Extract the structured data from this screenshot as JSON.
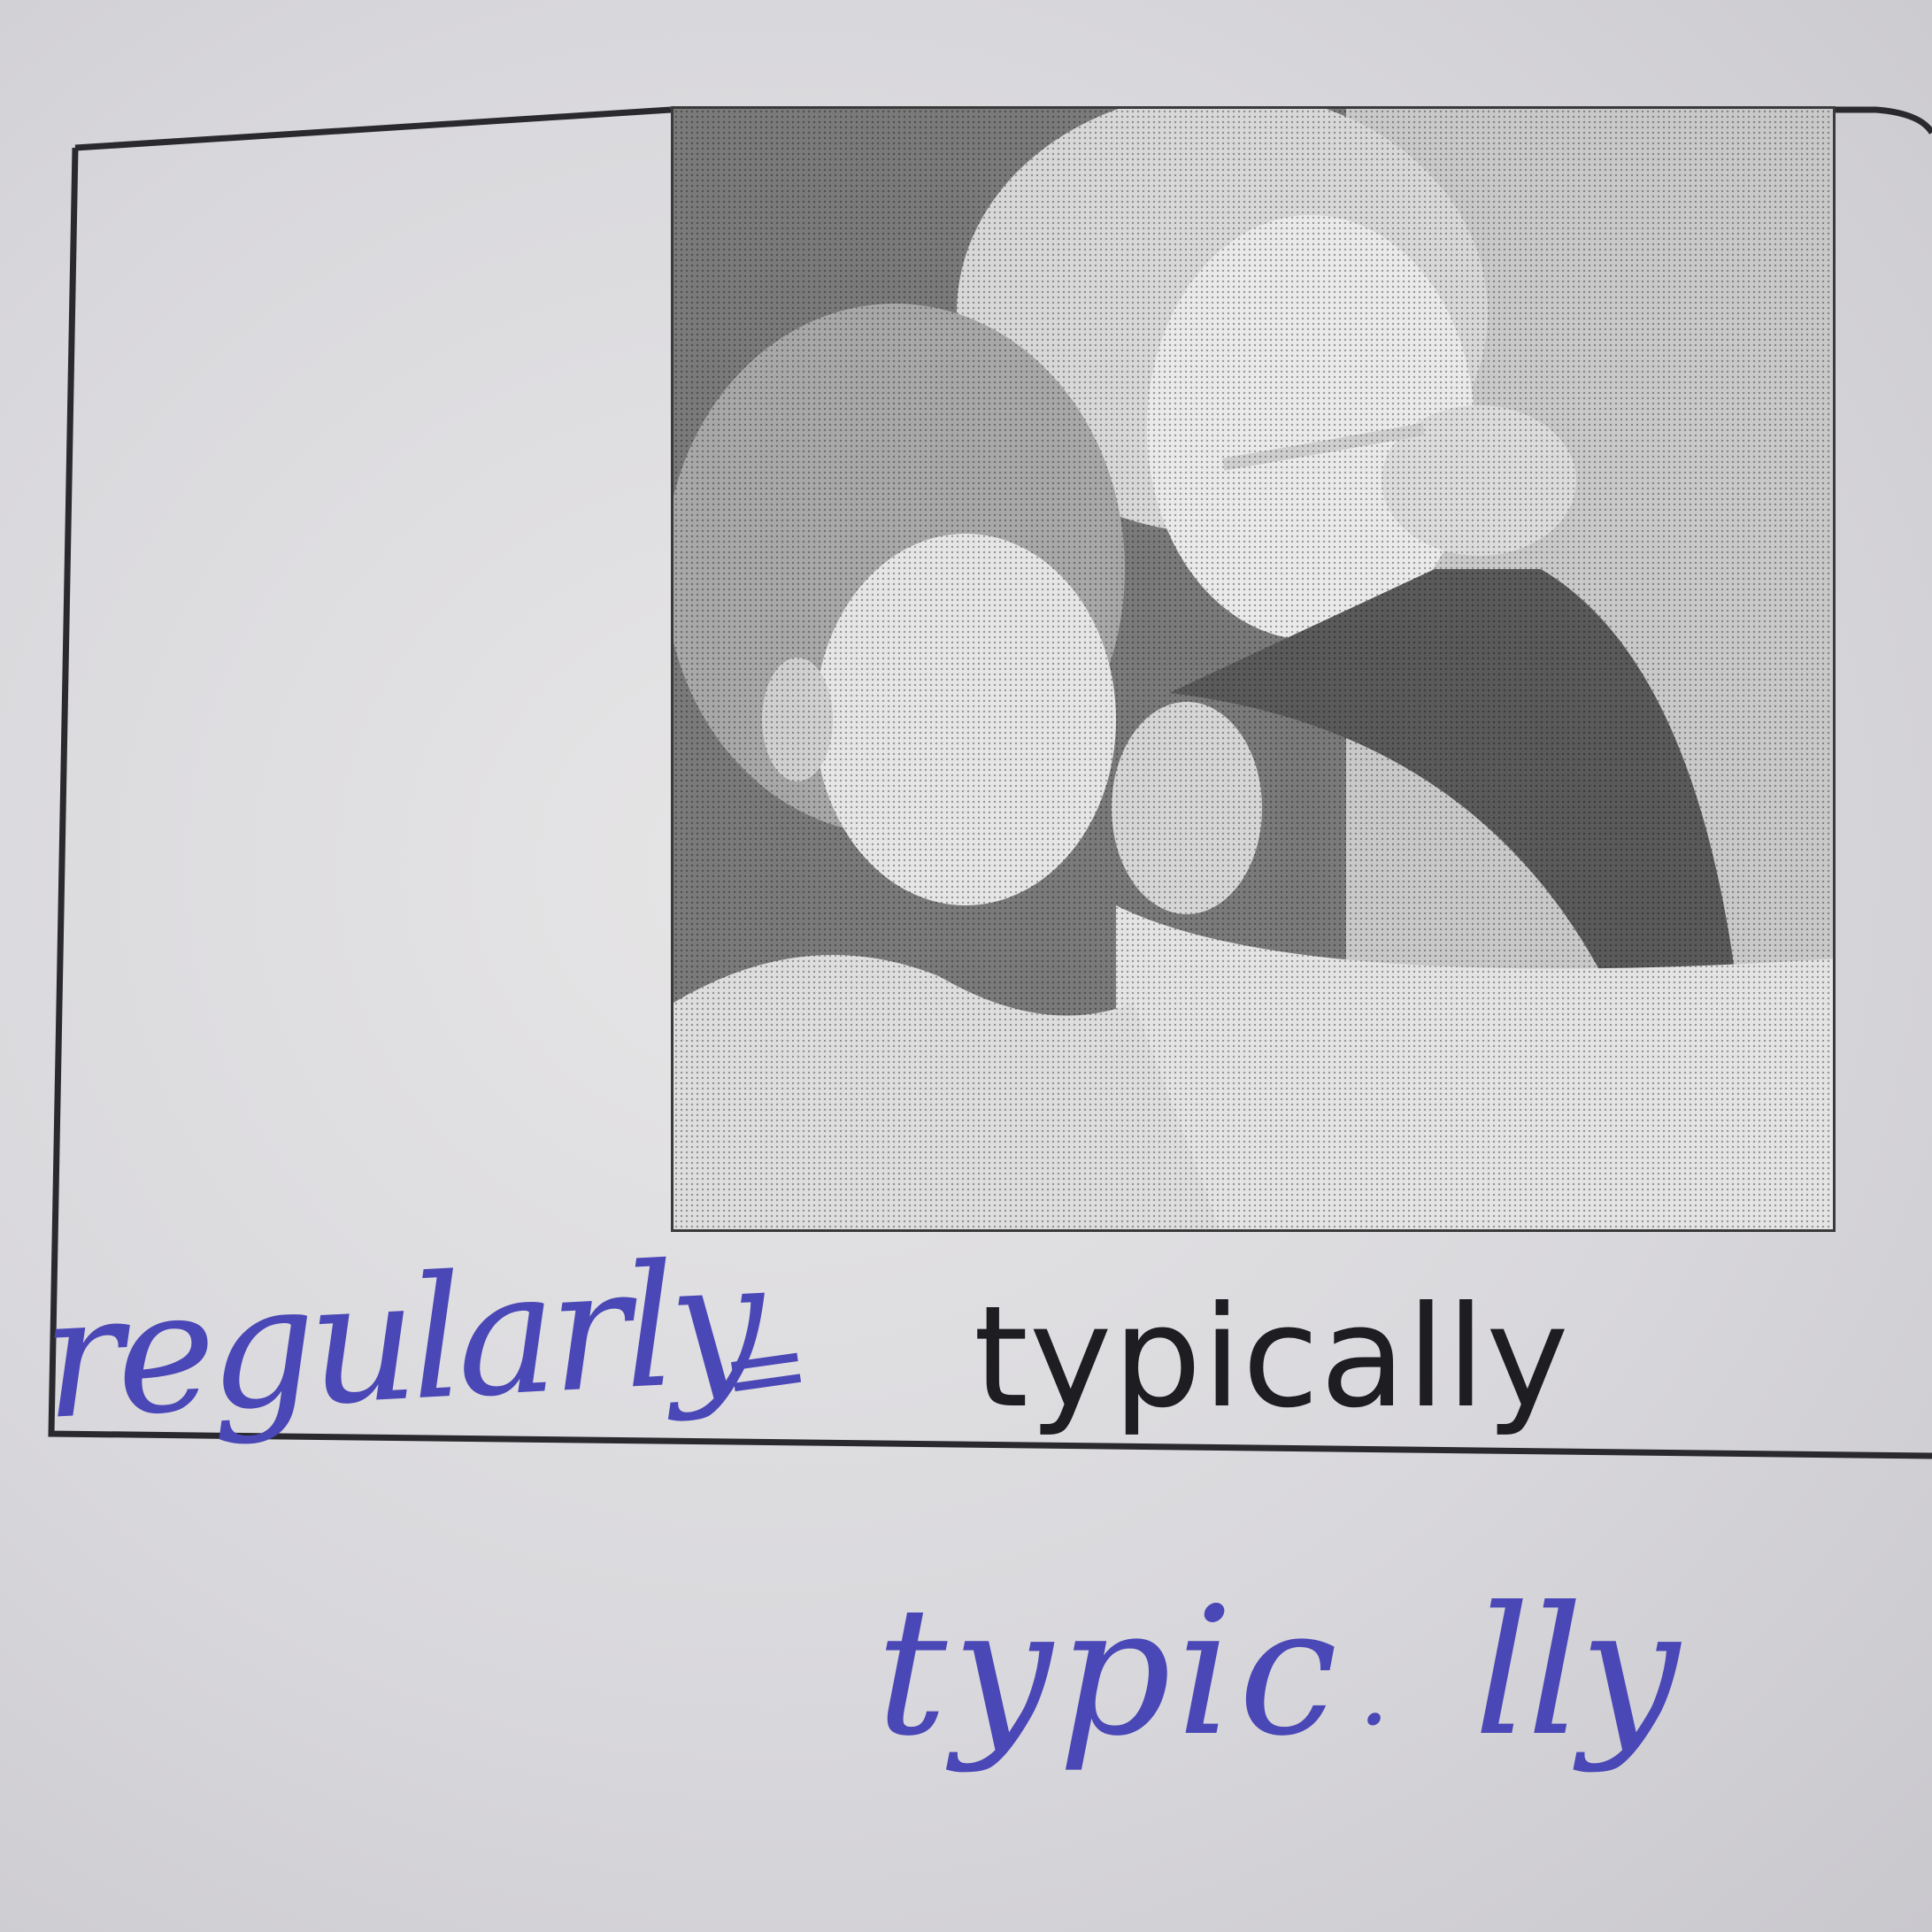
{
  "printed": {
    "word": "typically"
  },
  "handwriting": {
    "top_word": "regularly",
    "equals": "=",
    "typic": "typic",
    "dot": ".",
    "lly": "lly"
  },
  "colors": {
    "paper": "#dcdbdf",
    "ink_print": "#1e1e22",
    "ink_pen": "#4a47b6",
    "frame": "#2a2a2e"
  },
  "photo": {
    "description_icon": "mother-and-daughter-brushing-teeth-photo"
  }
}
